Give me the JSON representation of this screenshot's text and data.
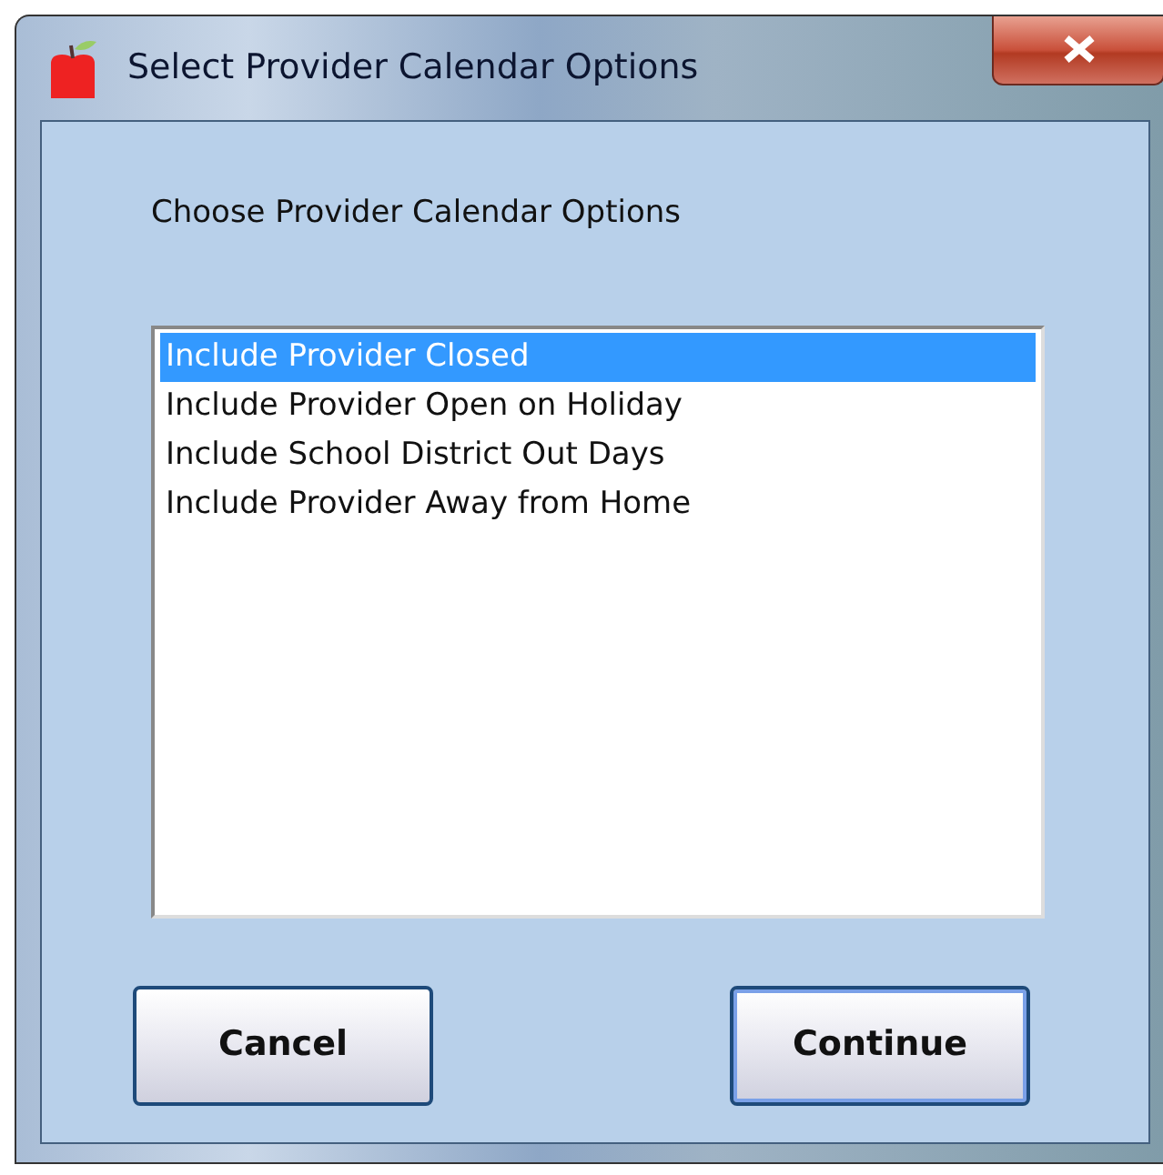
{
  "window": {
    "title": "Select Provider Calendar Options"
  },
  "prompt": "Choose Provider Calendar Options",
  "options": [
    {
      "label": "Include Provider Closed",
      "selected": true
    },
    {
      "label": "Include Provider Open on Holiday",
      "selected": false
    },
    {
      "label": "Include School District Out Days",
      "selected": false
    },
    {
      "label": "Include Provider Away from Home",
      "selected": false
    }
  ],
  "buttons": [
    {
      "label": "Cancel",
      "default": false
    },
    {
      "label": "Continue",
      "default": true
    }
  ]
}
